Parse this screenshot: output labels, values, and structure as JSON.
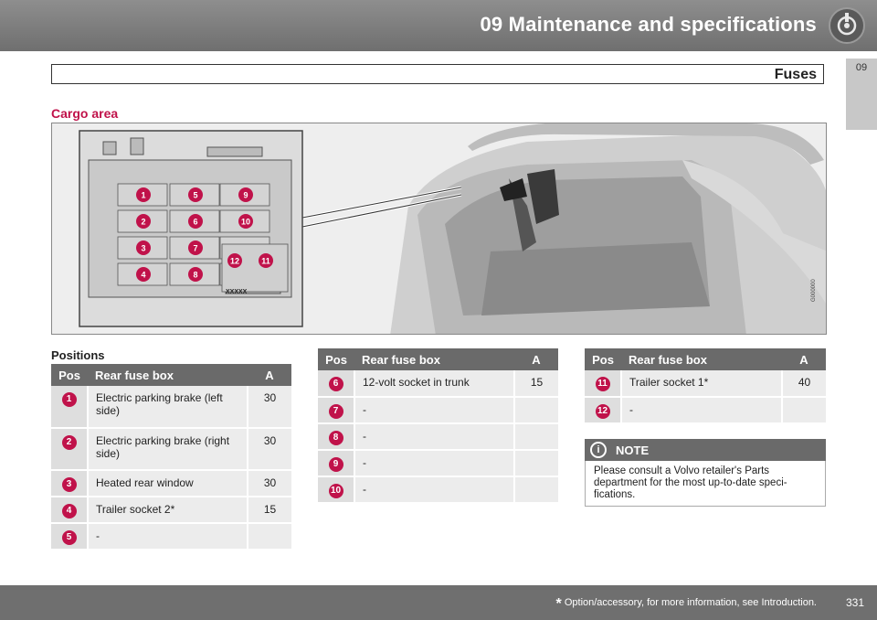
{
  "header": {
    "chapter_title": "09 Maintenance and specifications",
    "icon": "wrench-icon"
  },
  "side_tab": {
    "number": "09"
  },
  "section": {
    "title": "Fuses",
    "subheading": "Cargo area"
  },
  "figure": {
    "code": "G000000",
    "fuse_labels": [
      "1",
      "2",
      "3",
      "4",
      "5",
      "6",
      "7",
      "8",
      "9",
      "10",
      "11",
      "12"
    ],
    "box_marking": "XXXXX"
  },
  "positions_heading": "Positions",
  "table_headers": {
    "pos": "Pos",
    "desc": "Rear fuse box",
    "amp": "A"
  },
  "table1": [
    {
      "pos": "1",
      "desc": "Electric parking brake (left side)",
      "amp": "30"
    },
    {
      "pos": "2",
      "desc": "Electric parking brake (right side)",
      "amp": "30"
    },
    {
      "pos": "3",
      "desc": "Heated rear window",
      "amp": "30"
    },
    {
      "pos": "4",
      "desc": "Trailer socket 2*",
      "amp": "15"
    },
    {
      "pos": "5",
      "desc": "-",
      "amp": ""
    }
  ],
  "table2": [
    {
      "pos": "6",
      "desc": "12-volt socket in trunk",
      "amp": "15"
    },
    {
      "pos": "7",
      "desc": "-",
      "amp": ""
    },
    {
      "pos": "8",
      "desc": "-",
      "amp": ""
    },
    {
      "pos": "9",
      "desc": "-",
      "amp": ""
    },
    {
      "pos": "10",
      "desc": "-",
      "amp": ""
    }
  ],
  "table3": [
    {
      "pos": "11",
      "desc": "Trailer socket 1*",
      "amp": "40"
    },
    {
      "pos": "12",
      "desc": "-",
      "amp": ""
    }
  ],
  "note": {
    "title": "NOTE",
    "icon": "info-icon",
    "text": "Please consult a Volvo retailer's Parts department for the most up-to-date speci­fications."
  },
  "footer": {
    "asterisk": "*",
    "text": "Option/accessory, for more information, see Introduction.",
    "page": "331"
  },
  "colors": {
    "accent": "#c0124a",
    "header_gray": "#6f6f6f"
  }
}
